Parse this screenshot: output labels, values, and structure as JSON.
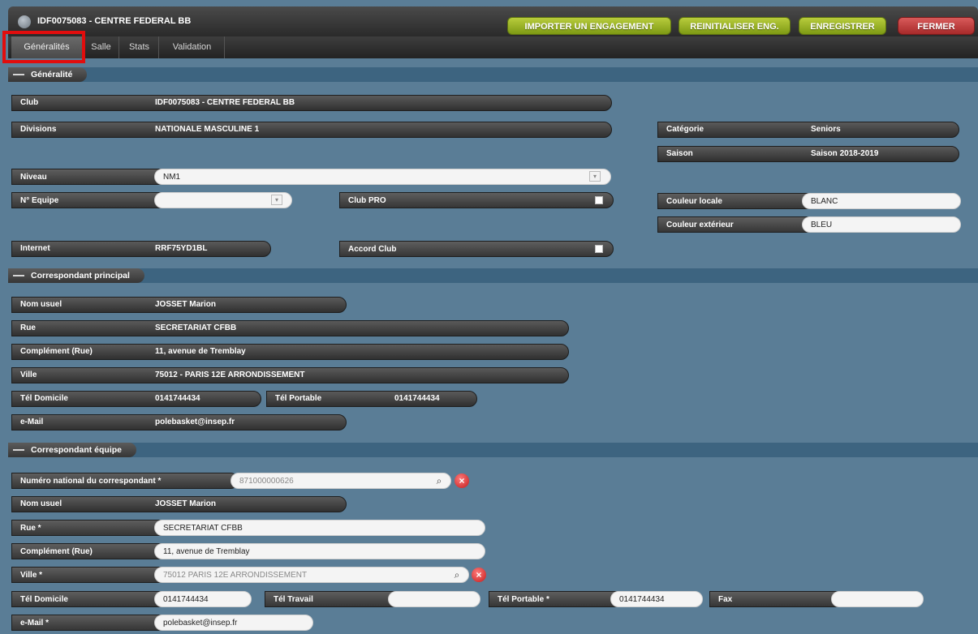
{
  "window": {
    "title": "IDF0075083 - CENTRE FEDERAL BB"
  },
  "toolbar": {
    "import": "IMPORTER UN ENGAGEMENT",
    "reset": "REINITIALISER ENG.",
    "save": "ENREGISTRER",
    "close": "FERMER"
  },
  "tabs": [
    "Généralités",
    "Salle",
    "Stats",
    "Validation"
  ],
  "sections": {
    "general": "Généralité",
    "principal": "Correspondant principal",
    "equipe": "Correspondant équipe"
  },
  "general": {
    "club_label": "Club",
    "club": "IDF0075083 - CENTRE FEDERAL BB",
    "divisions_label": "Divisions",
    "divisions": "NATIONALE MASCULINE 1",
    "categorie_label": "Catégorie",
    "categorie": "Seniors",
    "saison_label": "Saison",
    "saison": "Saison 2018-2019",
    "niveau_label": "Niveau",
    "niveau": "NM1",
    "equipe_label": "N° Equipe",
    "equipe": "",
    "clubpro_label": "Club PRO",
    "couleur_locale_label": "Couleur locale",
    "couleur_locale": "BLANC",
    "couleur_ext_label": "Couleur extérieur",
    "couleur_ext": "BLEU",
    "internet_label": "Internet",
    "internet": "RRF75YD1BL",
    "accord_label": "Accord Club"
  },
  "principal": {
    "nom_label": "Nom usuel",
    "nom": "JOSSET Marion",
    "rue_label": "Rue",
    "rue": "SECRETARIAT CFBB",
    "comp_label": "Complément (Rue)",
    "comp": "11, avenue de Tremblay",
    "ville_label": "Ville",
    "ville": "75012 - PARIS 12E ARRONDISSEMENT",
    "teldom_label": "Tél Domicile",
    "teldom": "0141744434",
    "telport_label": "Tél Portable",
    "telport": "0141744434",
    "mail_label": "e-Mail",
    "mail": "polebasket@insep.fr"
  },
  "equipe": {
    "numero_label": "Numéro national du correspondant *",
    "numero": "871000000626",
    "nom_label": "Nom usuel",
    "nom": "JOSSET Marion",
    "rue_label": "Rue *",
    "rue": "SECRETARIAT CFBB",
    "comp_label": "Complément (Rue)",
    "comp": "11, avenue de Tremblay",
    "ville_label": "Ville *",
    "ville": "75012 PARIS 12E ARRONDISSEMENT",
    "teldom_label": "Tél Domicile",
    "teldom": "0141744434",
    "teltrav_label": "Tél Travail",
    "teltrav": "",
    "telport_label": "Tél Portable *",
    "telport": "0141744434",
    "fax_label": "Fax",
    "fax": "",
    "mail_label": "e-Mail *",
    "mail": "polebasket@insep.fr"
  },
  "colors": {
    "background": "#5a7d96",
    "section": "#3d6480",
    "green": "#8fa820",
    "red": "#c03a3a",
    "highlight": "#e20d0d"
  }
}
